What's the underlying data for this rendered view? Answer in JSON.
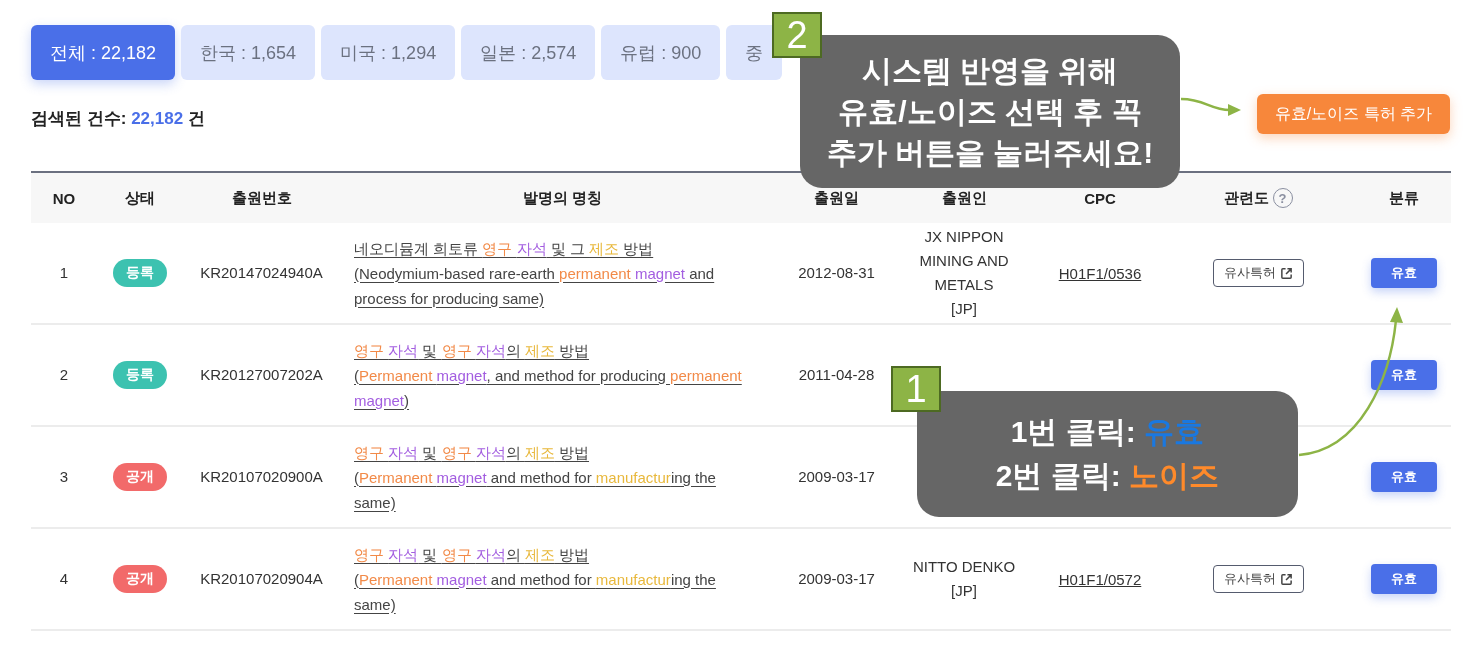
{
  "tabs": [
    {
      "label": "전체 : 22,182",
      "selected": true
    },
    {
      "label": "한국 : 1,654",
      "selected": false
    },
    {
      "label": "미국 : 1,294",
      "selected": false
    },
    {
      "label": "일본 : 2,574",
      "selected": false
    },
    {
      "label": "유럽 : 900",
      "selected": false
    },
    {
      "label": "중",
      "selected": false
    }
  ],
  "result_count": {
    "label": "검색된 건수:",
    "count": "22,182",
    "unit": "건"
  },
  "action_button": "유효/노이즈 특허 추가",
  "table": {
    "columns": [
      {
        "label": "NO"
      },
      {
        "label": "상태"
      },
      {
        "label": "출원번호"
      },
      {
        "label": "발명의 명칭"
      },
      {
        "label": "출원일"
      },
      {
        "label": "출원인"
      },
      {
        "label": "CPC"
      },
      {
        "label": "관련도",
        "help": "?"
      },
      {
        "label": "분류"
      }
    ],
    "rows": [
      {
        "no": "1",
        "status": {
          "label": "등록",
          "kind": "registered"
        },
        "app_no": "KR20147024940A",
        "title_ko": [
          {
            "text": "네오디뮴계 희토류 "
          },
          {
            "text": "영구 ",
            "color": "#f28a48"
          },
          {
            "text": "자석",
            "color": "#a35ee0"
          },
          {
            "text": " 및 그 "
          },
          {
            "text": "제조",
            "color": "#e8b83c"
          },
          {
            "text": " 방법"
          }
        ],
        "title_en": [
          {
            "text": "(Neodymium-based rare-earth "
          },
          {
            "text": "permanent ",
            "color": "#f28a48"
          },
          {
            "text": "magnet",
            "color": "#a35ee0"
          },
          {
            "text": " and process for producing same)"
          }
        ],
        "date": "2012-08-31",
        "applicant": "JX NIPPON MINING AND METALS",
        "country": "[JP]",
        "cpc": "H01F1/0536",
        "similar": "유사특허",
        "classification": "유효"
      },
      {
        "no": "2",
        "status": {
          "label": "등록",
          "kind": "registered"
        },
        "app_no": "KR20127007202A",
        "title_ko": [
          {
            "text": "영구 ",
            "color": "#f28a48"
          },
          {
            "text": "자석",
            "color": "#a35ee0"
          },
          {
            "text": " 및 "
          },
          {
            "text": "영구 ",
            "color": "#f28a48"
          },
          {
            "text": "자석",
            "color": "#a35ee0"
          },
          {
            "text": "의 "
          },
          {
            "text": "제조",
            "color": "#e8b83c"
          },
          {
            "text": " 방법"
          }
        ],
        "title_en": [
          {
            "text": "("
          },
          {
            "text": "Permanent ",
            "color": "#f28a48"
          },
          {
            "text": "magnet",
            "color": "#a35ee0"
          },
          {
            "text": ", and method for producing "
          },
          {
            "text": "permanent ",
            "color": "#f28a48"
          },
          {
            "text": "magnet",
            "color": "#a35ee0"
          },
          {
            "text": ")"
          }
        ],
        "date": "2011-04-28",
        "classification": "유효"
      },
      {
        "no": "3",
        "status": {
          "label": "공개",
          "kind": "published"
        },
        "app_no": "KR20107020900A",
        "title_ko": [
          {
            "text": "영구 ",
            "color": "#f28a48"
          },
          {
            "text": "자석",
            "color": "#a35ee0"
          },
          {
            "text": " 및 "
          },
          {
            "text": "영구 ",
            "color": "#f28a48"
          },
          {
            "text": "자석",
            "color": "#a35ee0"
          },
          {
            "text": "의 "
          },
          {
            "text": "제조",
            "color": "#e8b83c"
          },
          {
            "text": " 방법"
          }
        ],
        "title_en": [
          {
            "text": "("
          },
          {
            "text": "Permanent ",
            "color": "#f28a48"
          },
          {
            "text": "magnet",
            "color": "#a35ee0"
          },
          {
            "text": " and method for "
          },
          {
            "text": "manufactur",
            "color": "#e8b83c"
          },
          {
            "text": "ing the same)"
          }
        ],
        "date": "2009-03-17",
        "classification": "유효"
      },
      {
        "no": "4",
        "status": {
          "label": "공개",
          "kind": "published"
        },
        "app_no": "KR20107020904A",
        "title_ko": [
          {
            "text": "영구 ",
            "color": "#f28a48"
          },
          {
            "text": "자석",
            "color": "#a35ee0"
          },
          {
            "text": " 및 "
          },
          {
            "text": "영구 ",
            "color": "#f28a48"
          },
          {
            "text": "자석",
            "color": "#a35ee0"
          },
          {
            "text": "의 "
          },
          {
            "text": "제조",
            "color": "#e8b83c"
          },
          {
            "text": " 방법"
          }
        ],
        "title_en": [
          {
            "text": "("
          },
          {
            "text": "Permanent ",
            "color": "#f28a48"
          },
          {
            "text": "magnet",
            "color": "#a35ee0"
          },
          {
            "text": " and method for "
          },
          {
            "text": "manufactur",
            "color": "#e8b83c"
          },
          {
            "text": "ing the same)"
          }
        ],
        "date": "2009-03-17",
        "applicant": "NITTO DENKO",
        "country": "[JP]",
        "cpc": "H01F1/0572",
        "similar": "유사특허",
        "classification": "유효"
      }
    ]
  },
  "annotations": [
    {
      "number": "2",
      "lines": [
        [
          {
            "text": "시스템 반영을 위해"
          }
        ],
        [
          {
            "text": "유효/노이즈 선택 후 꼭"
          }
        ],
        [
          {
            "text": "추가 버튼을 눌러주세요!"
          }
        ]
      ]
    },
    {
      "number": "1",
      "lines": [
        [
          {
            "text": "1번 클릭: "
          },
          {
            "text": "유효",
            "color": "#1a78e0"
          }
        ],
        [
          {
            "text": "2번 클릭: "
          },
          {
            "text": "노이즈",
            "color": "#ff8a2a"
          }
        ]
      ]
    }
  ]
}
